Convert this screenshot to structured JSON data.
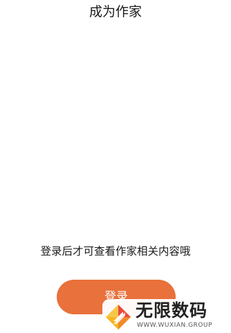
{
  "header": {
    "title": "成为作家"
  },
  "main": {
    "login_hint": "登录后才可查看作家相关内容哦",
    "login_button_label": "登录"
  },
  "watermark": {
    "logo_icon": "wuxian-logo-icon",
    "name": "无限数码",
    "url": "WWW.WUXIAN.GROUP"
  },
  "colors": {
    "accent": "#e8713c",
    "background": "#ffffff",
    "text": "#1a1a1a"
  }
}
